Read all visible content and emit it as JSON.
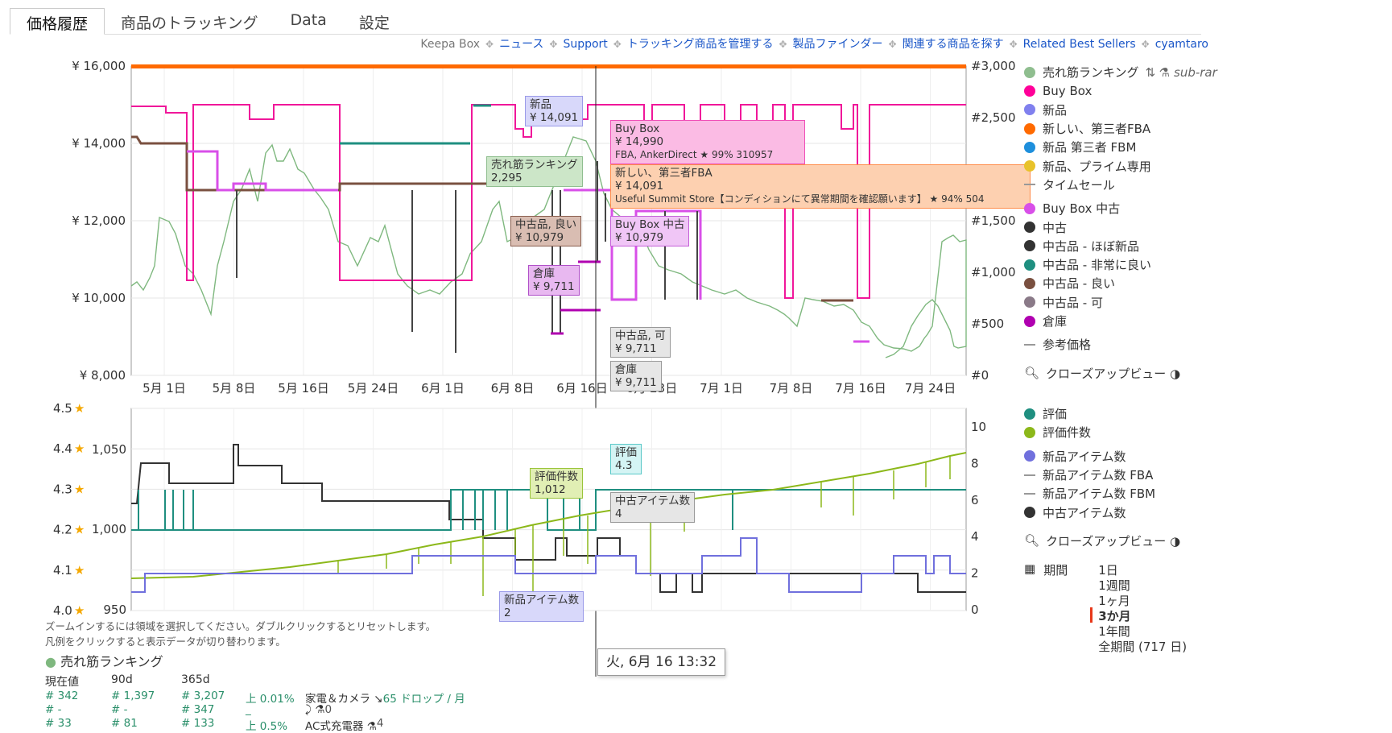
{
  "tabs": [
    "価格履歴",
    "商品のトラッキング",
    "Data",
    "設定"
  ],
  "toplinks": [
    {
      "label": "Keepa Box",
      "link": false
    },
    {
      "label": "ニュース",
      "link": true
    },
    {
      "label": "Support",
      "link": true
    },
    {
      "label": "トラッキング商品を管理する",
      "link": true
    },
    {
      "label": "製品ファインダー",
      "link": true
    },
    {
      "label": "関連する商品を探す",
      "link": true
    },
    {
      "label": "Related Best Sellers",
      "link": true
    },
    {
      "label": "cyamtaro",
      "link": true
    }
  ],
  "price_chart": {
    "y_left_ticks": [
      "¥ 16,000",
      "¥ 14,000",
      "¥ 12,000",
      "¥ 10,000",
      "¥ 8,000"
    ],
    "y_right_ticks": [
      "#3,000",
      "#2,500",
      "#2,000",
      "#1,500",
      "#1,000",
      "#500",
      "#0"
    ],
    "x_ticks": [
      "5月 1日",
      "5月 8日",
      "5月 16日",
      "5月 24日",
      "6月 1日",
      "6月 8日",
      "6月 16日",
      "6月 23日",
      "7月 1日",
      "7月 8日",
      "7月 16日",
      "7月 24日"
    ],
    "crosshair_label": "火, 6月 16 13:32"
  },
  "tooltips": {
    "new_title": "新品",
    "new_value": "¥ 14,091",
    "buybox_title": "Buy Box",
    "buybox_value": "¥ 14,990",
    "buybox_detail": "FBA, AnkerDirect ★ 99% 310957",
    "fba_title": "新しい、第三者FBA",
    "fba_value": "¥ 14,091",
    "fba_detail": "Useful Summit Store【コンディションにて異常期間を確認願います】 ★ 94% 504",
    "rank_title": "売れ筋ランキング",
    "rank_value": "2,295",
    "good_title": "中古品, 良い",
    "good_value": "¥ 10,979",
    "bbused_title": "Buy Box 中古",
    "bbused_value": "¥ 10,979",
    "wh_title": "倉庫",
    "wh_value": "¥ 9,711",
    "acc_title": "中古品, 可",
    "acc_value": "¥ 9,711",
    "wh2_title": "倉庫",
    "wh2_value": "¥ 9,711",
    "count_title": "評価件数",
    "count_value": "1,012",
    "rating_title": "評価",
    "rating_value": "4.3",
    "used_title": "中古アイテム数",
    "used_value": "4",
    "newitems_title": "新品アイテム数",
    "newitems_value": "2"
  },
  "stats_chart": {
    "y_left_star": [
      "4.5",
      "4.4",
      "4.3",
      "4.2",
      "4.1",
      "4.0"
    ],
    "y_left_count": [
      "1,050",
      "1,000",
      "950"
    ],
    "y_right": [
      "10",
      "8",
      "6",
      "4",
      "2",
      "0"
    ]
  },
  "legend1": [
    {
      "label": "売れ筋ランキング",
      "color": "#8fbe8f",
      "type": "dot"
    },
    {
      "label": "Buy Box",
      "color": "#ff0099",
      "type": "dot"
    },
    {
      "label": "新品",
      "color": "#8080ee",
      "type": "dot"
    },
    {
      "label": "新しい、第三者FBA",
      "color": "#ff6a00",
      "type": "dot"
    },
    {
      "label": "新品 第三者 FBM",
      "color": "#1e8fdc",
      "type": "dot"
    },
    {
      "label": "新品、プライム専用",
      "color": "#e8c22a",
      "type": "dot"
    },
    {
      "label": "タイムセール",
      "color": "#999",
      "type": "dash"
    },
    {
      "label": "Buy Box 中古",
      "color": "#d84fe8",
      "type": "dot"
    },
    {
      "label": "中古",
      "color": "#333",
      "type": "dot"
    },
    {
      "label": "中古品 - ほぼ新品",
      "color": "#333",
      "type": "dot"
    },
    {
      "label": "中古品 - 非常に良い",
      "color": "#1f8f80",
      "type": "dot"
    },
    {
      "label": "中古品 - 良い",
      "color": "#7a5040",
      "type": "dot"
    },
    {
      "label": "中古品 - 可",
      "color": "#8a7a88",
      "type": "dot"
    },
    {
      "label": "倉庫",
      "color": "#b000b0",
      "type": "dot"
    },
    {
      "label": "参考価格",
      "color": "#999",
      "type": "dash"
    }
  ],
  "legend1_extra": "sub-rar",
  "closeup_label": "クローズアップビュー",
  "legend2": [
    {
      "label": "評価",
      "color": "#1f8f80",
      "type": "dot"
    },
    {
      "label": "評価件数",
      "color": "#8cb81a",
      "type": "dot"
    },
    {
      "label": "新品アイテム数",
      "color": "#7070dd",
      "type": "dot"
    },
    {
      "label": "新品アイテム数 FBA",
      "color": "#999",
      "type": "dash"
    },
    {
      "label": "新品アイテム数 FBM",
      "color": "#999",
      "type": "dash"
    },
    {
      "label": "中古アイテム数",
      "color": "#333",
      "type": "dot"
    }
  ],
  "period": {
    "label": "期間",
    "options": [
      "1日",
      "1週間",
      "1ヶ月",
      "3か月",
      "1年間",
      "全期間 (717 日)"
    ],
    "selected": "3か月"
  },
  "hints": [
    "ズームインするには領域を選択してください。ダブルクリックするとリセットします。",
    "凡例をクリックすると表示データが切り替わります。"
  ],
  "stats": {
    "title": "売れ筋ランキング",
    "headers": [
      "現在値",
      "90d",
      "365d"
    ],
    "rows": [
      {
        "now": "342",
        "d90": "1,397",
        "d365": "3,207",
        "trend": "上 0.01%",
        "cat": "家電＆カメラ",
        "extra": "65 ドロップ / 月"
      },
      {
        "now": "-",
        "d90": "-",
        "d365": "347",
        "trend": "_",
        "cat": "",
        "extra": "0"
      },
      {
        "now": "33",
        "d90": "81",
        "d365": "133",
        "trend": "上 0.5%",
        "cat": "AC式充電器",
        "extra": "4"
      }
    ]
  }
}
